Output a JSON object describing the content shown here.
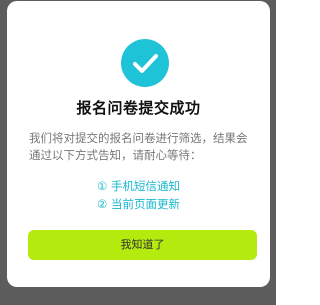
{
  "colors": {
    "accent": "#1ec3d8",
    "method_text": "#19b9d0",
    "button_bg": "#b4ea0e",
    "overlay": "rgba(0,0,0,0.62)"
  },
  "modal": {
    "icon": "check-circle-icon",
    "title": "报名问卷提交成功",
    "description": "我们将对提交的报名问卷进行筛选，结果会通过以下方式告知，请耐心等待：",
    "methods": [
      "① 手机短信通知",
      "② 当前页面更新"
    ],
    "confirm_label": "我知道了"
  }
}
